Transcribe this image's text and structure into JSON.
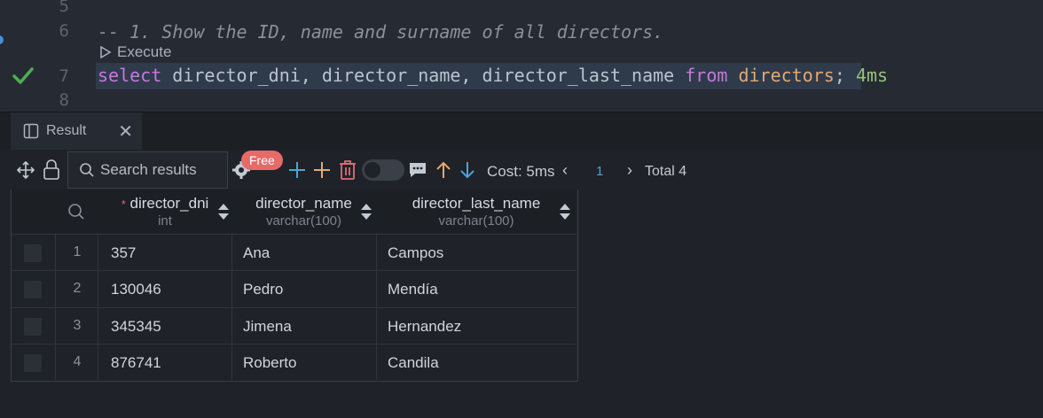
{
  "editor": {
    "lines": [
      {
        "num": "5",
        "text": ""
      },
      {
        "num": "6",
        "text": "-- 1. Show the ID, name and surname of all directors."
      },
      {
        "num": "7",
        "text": ""
      },
      {
        "num": "8",
        "text": ""
      }
    ],
    "execute_label": "Execute",
    "sql": {
      "kw_select": "select",
      "columns": " director_dni, director_name, director_last_name ",
      "kw_from": "from",
      "table": " directors",
      "semicolon": ";",
      "timing": "4ms"
    }
  },
  "result_tab": {
    "label": "Result",
    "close": "✕"
  },
  "toolbar": {
    "search_placeholder": "Search results",
    "free_badge": "Free",
    "cost": "Cost: 5ms",
    "prev": "‹",
    "page": "1",
    "next": "›",
    "total": "Total 4"
  },
  "table": {
    "columns": [
      {
        "name": "director_dni",
        "type": "int",
        "required": "*"
      },
      {
        "name": "director_name",
        "type": "varchar(100)"
      },
      {
        "name": "director_last_name",
        "type": "varchar(100)"
      }
    ],
    "rows": [
      {
        "n": "1",
        "dni": "357",
        "name": "Ana",
        "last": "Campos"
      },
      {
        "n": "2",
        "dni": "130046",
        "name": "Pedro",
        "last": "Mendía"
      },
      {
        "n": "3",
        "dni": "345345",
        "name": "Jimena",
        "last": "Hernandez"
      },
      {
        "n": "4",
        "dni": "876741",
        "name": "Roberto",
        "last": "Candila"
      }
    ]
  },
  "colors": {
    "accent": "#4aa3e0",
    "keyword": "#c678dd",
    "table": "#e5a86e",
    "ok": "#98c379",
    "badge": "#e66a6a"
  }
}
